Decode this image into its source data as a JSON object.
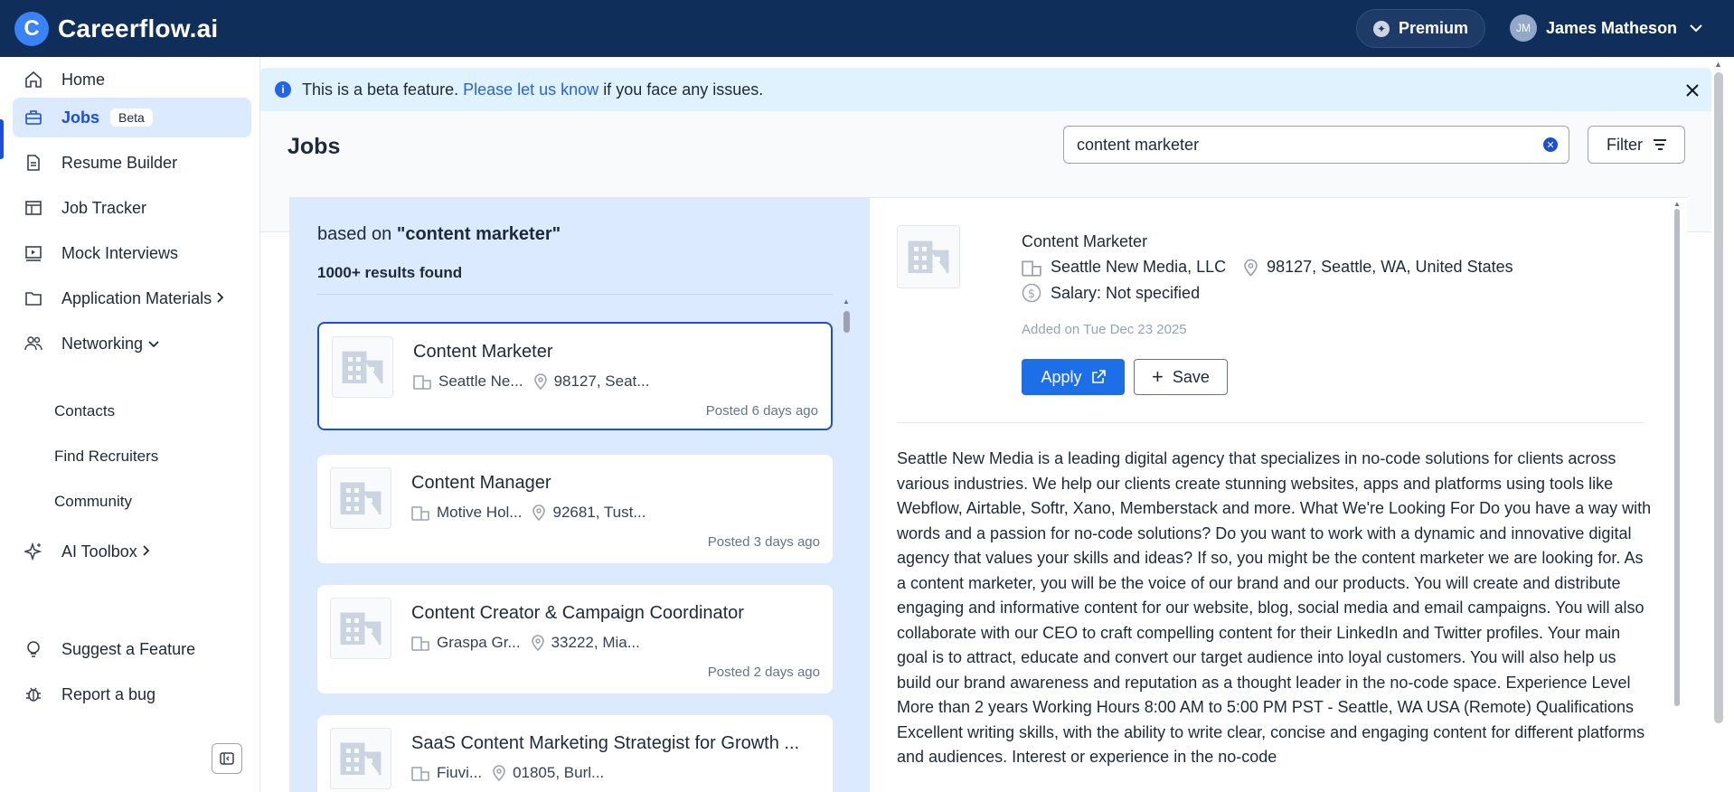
{
  "topbar": {
    "brand_letter": "C",
    "brand_name": "Careerflow.ai",
    "premium_label": "Premium",
    "user_initials": "JM",
    "user_name": "James Matheson"
  },
  "sidebar": {
    "items": [
      {
        "label": "Home",
        "icon": "home-icon"
      },
      {
        "label": "Jobs",
        "icon": "briefcase-icon",
        "badge": "Beta"
      },
      {
        "label": "Resume Builder",
        "icon": "document-icon"
      },
      {
        "label": "Job Tracker",
        "icon": "table-icon"
      },
      {
        "label": "Mock Interviews",
        "icon": "video-icon"
      },
      {
        "label": "Application Materials",
        "icon": "folder-icon"
      },
      {
        "label": "Networking",
        "icon": "people-icon"
      },
      {
        "label": "AI Toolbox",
        "icon": "sparkle-icon"
      },
      {
        "label": "Suggest a Feature",
        "icon": "lightbulb-icon"
      },
      {
        "label": "Report a bug",
        "icon": "bug-icon"
      }
    ],
    "networking_subitems": [
      "Contacts",
      "Find Recruiters",
      "Community"
    ]
  },
  "banner": {
    "text_before": "This is a beta feature.",
    "link": "Please let us know",
    "text_after": "if you face any issues."
  },
  "jobs": {
    "title": "Jobs",
    "search_value": "content marketer",
    "filter_label": "Filter",
    "based_on_prefix": "based on",
    "based_on_query": "\"content marketer\"",
    "result_count": "1000+ results found"
  },
  "job_cards": [
    {
      "title": "Content Marketer",
      "company": "Seattle Ne...",
      "location": "98127, Seat...",
      "posted": "Posted 6 days ago"
    },
    {
      "title": "Content Manager",
      "company": "Motive Hol...",
      "location": "92681, Tust...",
      "posted": "Posted 3 days ago"
    },
    {
      "title": "Content Creator & Campaign Coordinator",
      "company": "Graspa Gr...",
      "location": "33222, Mia...",
      "posted": "Posted 2 days ago"
    },
    {
      "title": "SaaS Content Marketing Strategist for Growth ...",
      "company": "Fiuvi...",
      "location": "01805, Burl...",
      "posted": ""
    }
  ],
  "detail": {
    "title": "Content Marketer",
    "company": "Seattle New Media, LLC",
    "location": "98127, Seattle, WA, United States",
    "salary": "Salary: Not specified",
    "added": "Added on Tue Dec 23 2025",
    "apply_label": "Apply",
    "save_label": "Save",
    "description": "Seattle New Media is a leading digital agency that specializes in no-code solutions for clients across various industries. We help our clients create stunning websites, apps and platforms using tools like Webflow, Airtable, Softr, Xano, Memberstack and more. What We're Looking For Do you have a way with words and a passion for no-code solutions? Do you want to work with a dynamic and innovative digital agency that values your skills and ideas? If so, you might be the content marketer we are looking for. As a content marketer, you will be the voice of our brand and our products. You will create and distribute engaging and informative content for our website, blog, social media and email campaigns. You will also collaborate with our CEO to craft compelling content for their LinkedIn and Twitter profiles. Your main goal is to attract, educate and convert our target audience into loyal customers. You will also help us build our brand awareness and reputation as a thought leader in the no-code space. Experience Level More than 2 years Working Hours 8:00 AM to 5:00 PM PST - Seattle, WA USA (Remote) Qualifications Excellent writing skills, with the ability to write clear, concise and engaging content for different platforms and audiences. Interest or experience in the no-code"
  },
  "colors": {
    "topbar": "#0f2f5a",
    "accent": "#1d4ed8",
    "apply": "#1d6fe8",
    "results_bg": "#dbeafe",
    "banner_bg": "#e0f2fe"
  }
}
